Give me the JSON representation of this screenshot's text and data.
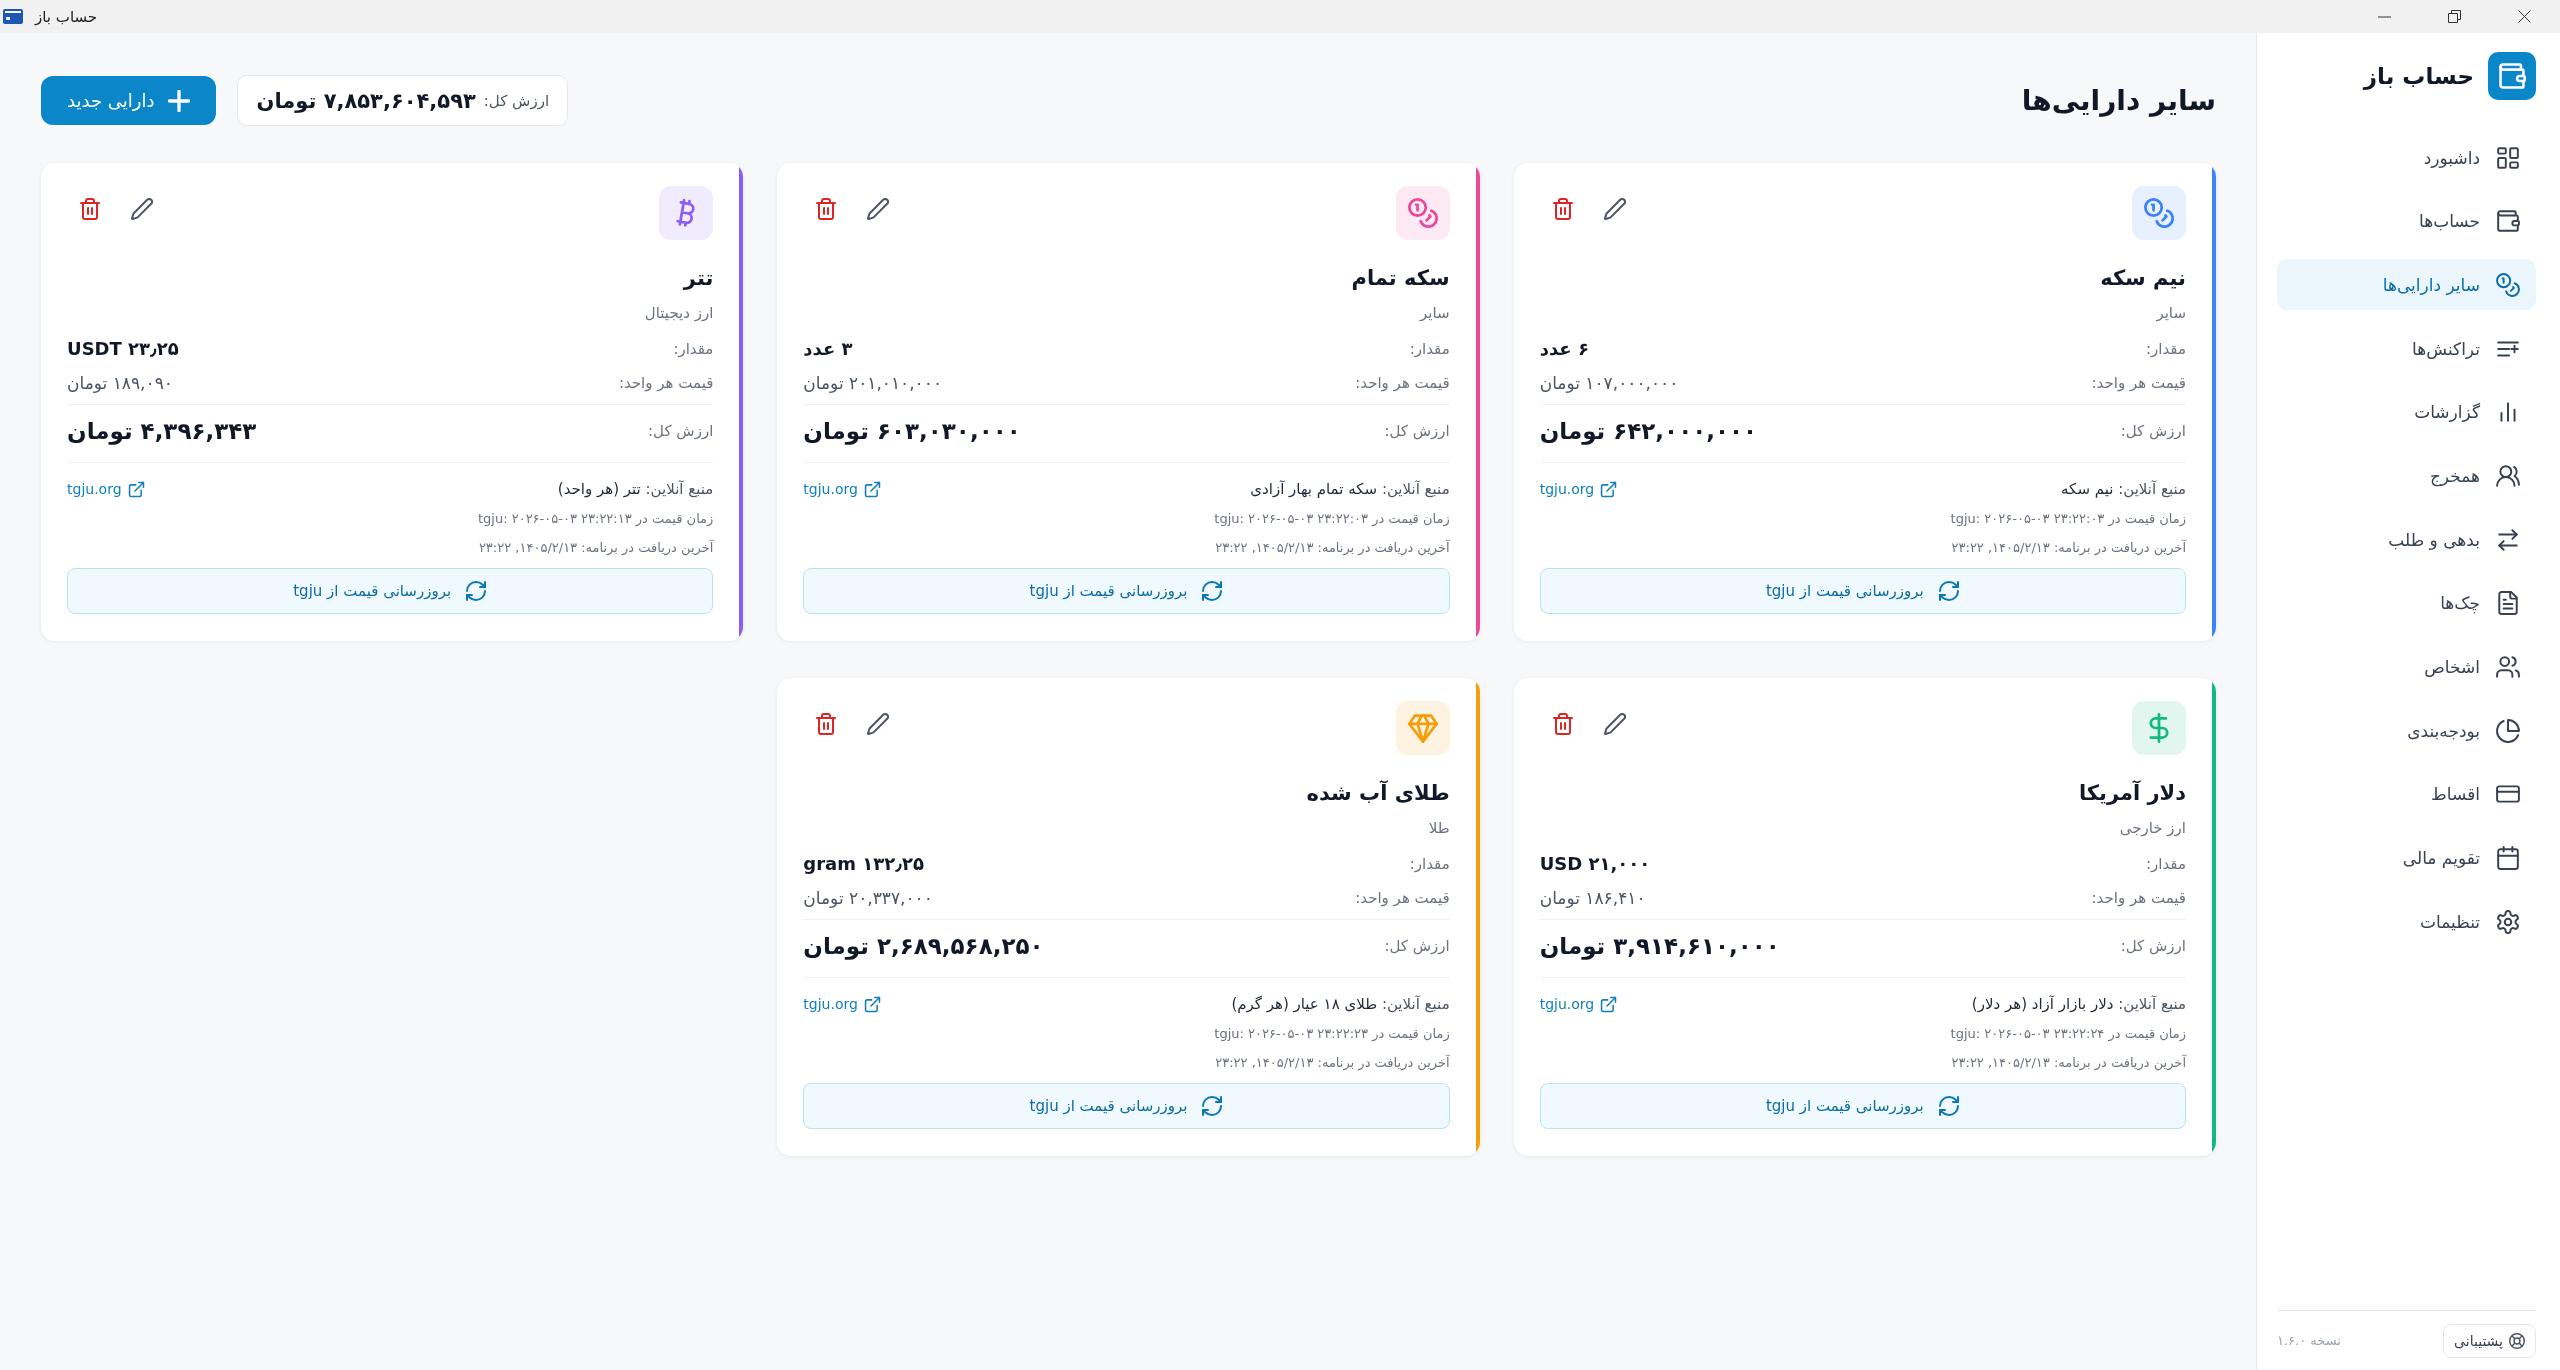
{
  "window": {
    "title": "حساب باز"
  },
  "sidebar": {
    "brand": "حساب باز",
    "items": [
      {
        "label": "داشبورد",
        "selected": false
      },
      {
        "label": "حساب‌ها",
        "selected": false
      },
      {
        "label": "سایر دارایی‌ها",
        "selected": true
      },
      {
        "label": "تراکنش‌ها",
        "selected": false
      },
      {
        "label": "گزارشات",
        "selected": false
      },
      {
        "label": "همخرج",
        "selected": false
      },
      {
        "label": "بدهی و طلب",
        "selected": false
      },
      {
        "label": "چک‌ها",
        "selected": false
      },
      {
        "label": "اشخاص",
        "selected": false
      },
      {
        "label": "بودجه‌بندی",
        "selected": false
      },
      {
        "label": "اقساط",
        "selected": false
      },
      {
        "label": "تقویم مالی",
        "selected": false
      },
      {
        "label": "تنظیمات",
        "selected": false
      }
    ],
    "support_button": "پشتیبانی",
    "version": "نسخه ۱.۶.۰"
  },
  "page": {
    "title": "سایر دارایی‌ها",
    "total_label": "ارزش کل:",
    "total_value": "۷,۸۵۳,۶۰۴,۵۹۳ تومان",
    "new_button": "دارایی جدید"
  },
  "assets": [
    {
      "kind": "coin",
      "color": "#3b82f6",
      "name": "نیم سکه",
      "category": "سایر",
      "quantity_label": "مقدار:",
      "quantity": "۶ عدد",
      "unit_price_label": "قیمت هر واحد:",
      "unit_price": "۱۰۷,۰۰۰,۰۰۰ تومان",
      "total_label": "ارزش کل:",
      "total": "۶۴۲,۰۰۰,۰۰۰ تومان",
      "source_label": "منبع آنلاین:",
      "source": "نیم سکه",
      "link": "tgju.org",
      "price_time": "زمان قیمت در tgju: ۲۰۲۶-۰۵-۰۳ ۲۳:۲۲:۰۳",
      "fetched": "آخرین دریافت در برنامه: ۱۴۰۵/۲/۱۳, ۲۳:۲۲",
      "update_button": "بروزرسانی قیمت از tgju"
    },
    {
      "kind": "coin",
      "color": "#ec4899",
      "name": "سکه تمام",
      "category": "سایر",
      "quantity_label": "مقدار:",
      "quantity": "۳ عدد",
      "unit_price_label": "قیمت هر واحد:",
      "unit_price": "۲۰۱,۰۱۰,۰۰۰ تومان",
      "total_label": "ارزش کل:",
      "total": "۶۰۳,۰۳۰,۰۰۰ تومان",
      "source_label": "منبع آنلاین:",
      "source": "سکه تمام بهار آزادی",
      "link": "tgju.org",
      "price_time": "زمان قیمت در tgju: ۲۰۲۶-۰۵-۰۳ ۲۳:۲۲:۰۳",
      "fetched": "آخرین دریافت در برنامه: ۱۴۰۵/۲/۱۳, ۲۳:۲۲",
      "update_button": "بروزرسانی قیمت از tgju"
    },
    {
      "kind": "crypto",
      "color": "#8b5cf6",
      "name": "تتر",
      "category": "ارز دیجیتال",
      "quantity_label": "مقدار:",
      "quantity": "۲۳٫۲۵ USDT",
      "unit_price_label": "قیمت هر واحد:",
      "unit_price": "۱۸۹,۰۹۰ تومان",
      "total_label": "ارزش کل:",
      "total": "۴,۳۹۶,۳۴۳ تومان",
      "source_label": "منبع آنلاین:",
      "source": "تتر (هر واحد)",
      "link": "tgju.org",
      "price_time": "زمان قیمت در tgju: ۲۰۲۶-۰۵-۰۳ ۲۳:۲۲:۱۳",
      "fetched": "آخرین دریافت در برنامه: ۱۴۰۵/۲/۱۳, ۲۳:۲۲",
      "update_button": "بروزرسانی قیمت از tgju"
    },
    {
      "kind": "currency",
      "color": "#10b981",
      "name": "دلار آمریکا",
      "category": "ارز خارجی",
      "quantity_label": "مقدار:",
      "quantity": "۲۱,۰۰۰ USD",
      "unit_price_label": "قیمت هر واحد:",
      "unit_price": "۱۸۶,۴۱۰ تومان",
      "total_label": "ارزش کل:",
      "total": "۳,۹۱۴,۶۱۰,۰۰۰ تومان",
      "source_label": "منبع آنلاین:",
      "source": "دلار بازار آزاد (هر دلار)",
      "link": "tgju.org",
      "price_time": "زمان قیمت در tgju: ۲۰۲۶-۰۵-۰۳ ۲۳:۲۲:۲۴",
      "fetched": "آخرین دریافت در برنامه: ۱۴۰۵/۲/۱۳, ۲۳:۲۲",
      "update_button": "بروزرسانی قیمت از tgju"
    },
    {
      "kind": "gold",
      "color": "#f59e0b",
      "name": "طلای آب شده",
      "category": "طلا",
      "quantity_label": "مقدار:",
      "quantity": "۱۳۲٫۲۵ gram",
      "unit_price_label": "قیمت هر واحد:",
      "unit_price": "۲۰,۳۳۷,۰۰۰ تومان",
      "total_label": "ارزش کل:",
      "total": "۲,۶۸۹,۵۶۸,۲۵۰ تومان",
      "source_label": "منبع آنلاین:",
      "source": "طلای ۱۸ عیار (هر گرم)",
      "link": "tgju.org",
      "price_time": "زمان قیمت در tgju: ۲۰۲۶-۰۵-۰۳ ۲۳:۲۲:۲۳",
      "fetched": "آخرین دریافت در برنامه: ۱۴۰۵/۲/۱۳, ۲۳:۲۲",
      "update_button": "بروزرسانی قیمت از tgju"
    }
  ]
}
